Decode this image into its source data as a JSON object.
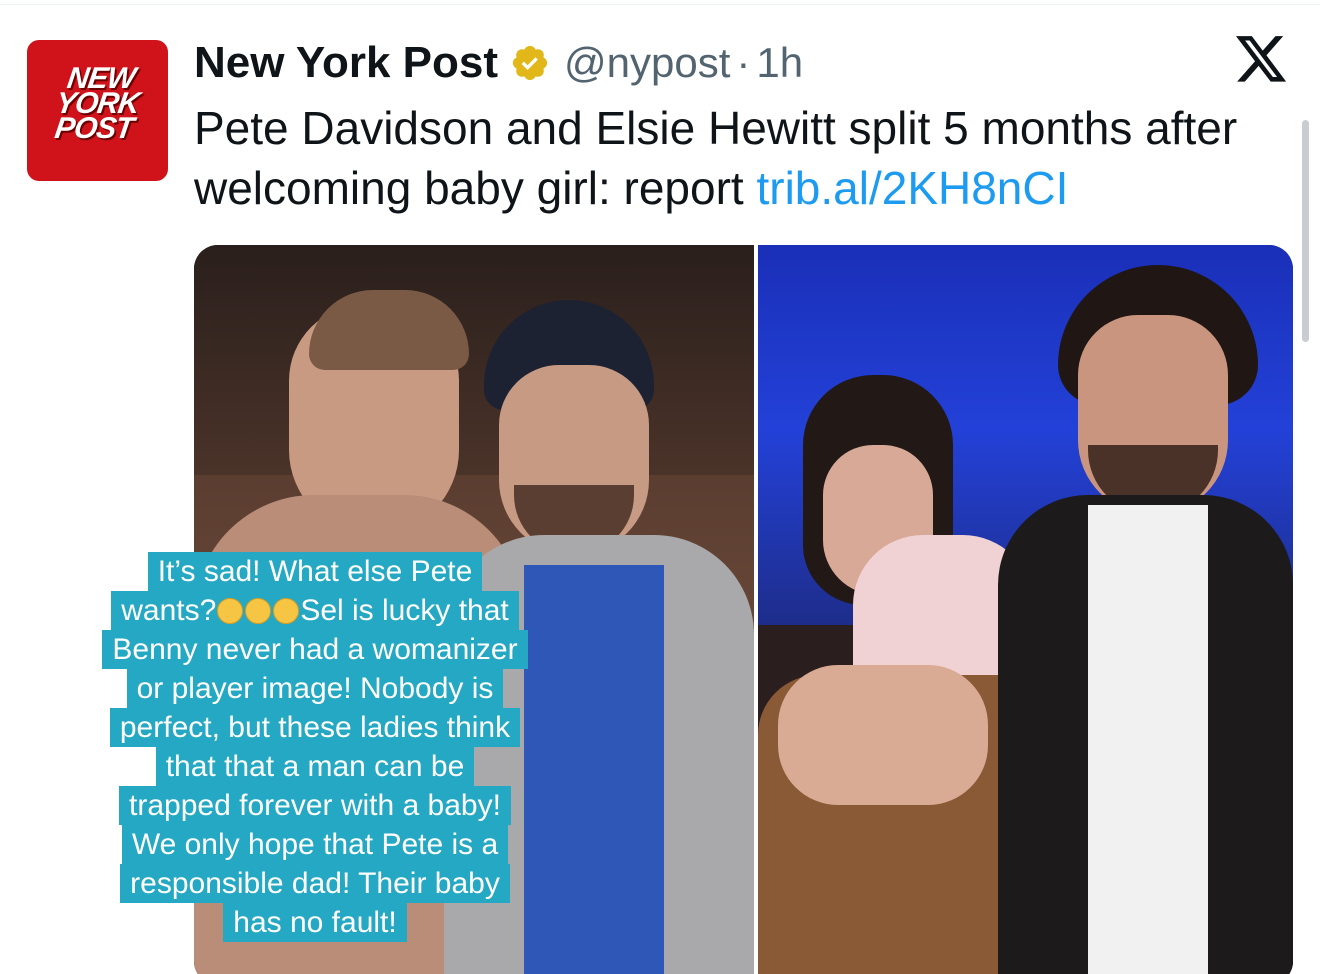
{
  "account": {
    "avatar_text": "NEW\nYORK\nPOST",
    "display_name": "New York Post",
    "handle": "@nypost",
    "separator": "·",
    "timestamp": "1h"
  },
  "tweet": {
    "text": "Pete Davidson and Elsie Hewitt split 5 months after welcoming baby girl: report ",
    "link": "trib.al/2KH8nCI"
  },
  "caption": {
    "lines": [
      "It’s sad! What else Pete",
      "wants?",
      "Sel is lucky that",
      "Benny never had a womanizer",
      "or player image! Nobody is",
      "perfect, but these ladies think",
      "that that a man can be",
      "trapped forever with a baby!",
      "We only hope that Pete is a",
      "responsible dad! Their baby",
      "has no fault!"
    ]
  },
  "colors": {
    "link": "#1d9bf0",
    "verified": "#e2b719",
    "brand_red": "#d0121b",
    "caption_bg": "#25a8c3",
    "secondary_text": "#536471"
  },
  "icons": {
    "verified": "verified-badge-icon",
    "close": "x-logo-icon"
  }
}
